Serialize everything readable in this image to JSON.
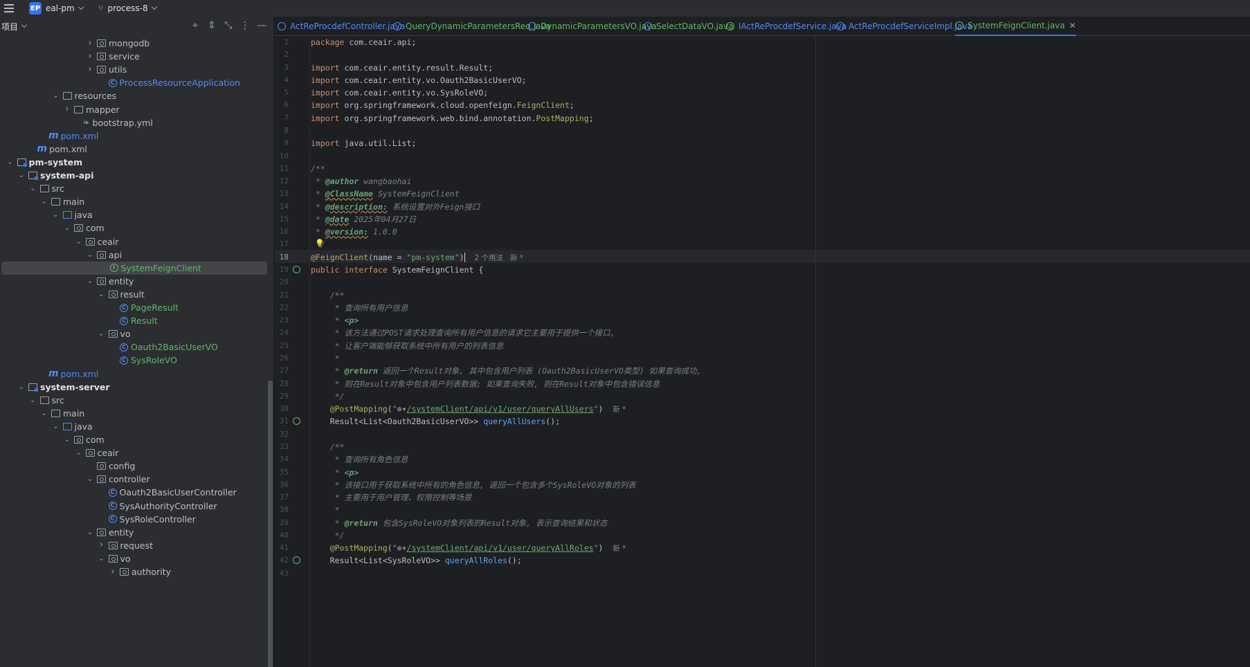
{
  "titlebar": {
    "project_badge": "EP",
    "project_name": "eal-pm",
    "branch": "process-8"
  },
  "project_panel": {
    "title": "项目",
    "tree": [
      {
        "label": "mongodb",
        "depth": 8,
        "icon": "package",
        "arrow": "closed"
      },
      {
        "label": "service",
        "depth": 8,
        "icon": "package",
        "arrow": "closed"
      },
      {
        "label": "utils",
        "depth": 8,
        "icon": "package",
        "arrow": "closed"
      },
      {
        "label": "ProcessResourceApplication",
        "depth": 9,
        "icon": "class",
        "color": "blue"
      },
      {
        "label": "resources",
        "depth": 5,
        "icon": "folder",
        "arrow": "open"
      },
      {
        "label": "mapper",
        "depth": 6,
        "icon": "folder",
        "arrow": "closed"
      },
      {
        "label": "bootstrap.yml",
        "depth": 7,
        "icon": "yaml"
      },
      {
        "label": "pom.xml",
        "depth": 4,
        "icon": "maven",
        "color": "blue"
      },
      {
        "label": "pom.xml",
        "depth": 3,
        "icon": "maven"
      },
      {
        "label": "pm-system",
        "depth": 1,
        "icon": "module",
        "arrow": "open",
        "bold": true
      },
      {
        "label": "system-api",
        "depth": 2,
        "icon": "module",
        "arrow": "open",
        "bold": true
      },
      {
        "label": "src",
        "depth": 3,
        "icon": "folder",
        "arrow": "open"
      },
      {
        "label": "main",
        "depth": 4,
        "icon": "folder",
        "arrow": "open"
      },
      {
        "label": "java",
        "depth": 5,
        "icon": "source",
        "arrow": "open"
      },
      {
        "label": "com",
        "depth": 6,
        "icon": "package",
        "arrow": "open"
      },
      {
        "label": "ceair",
        "depth": 7,
        "icon": "package",
        "arrow": "open"
      },
      {
        "label": "api",
        "depth": 8,
        "icon": "package",
        "arrow": "open"
      },
      {
        "label": "SystemFeignClient",
        "depth": 9,
        "icon": "interface",
        "color": "green",
        "selected": true
      },
      {
        "label": "entity",
        "depth": 8,
        "icon": "package",
        "arrow": "open"
      },
      {
        "label": "result",
        "depth": 9,
        "icon": "package",
        "arrow": "open"
      },
      {
        "label": "PageResult",
        "depth": 10,
        "icon": "class",
        "color": "green"
      },
      {
        "label": "Result",
        "depth": 10,
        "icon": "class",
        "color": "green"
      },
      {
        "label": "vo",
        "depth": 9,
        "icon": "package",
        "arrow": "open"
      },
      {
        "label": "Oauth2BasicUserVO",
        "depth": 10,
        "icon": "class",
        "color": "green"
      },
      {
        "label": "SysRoleVO",
        "depth": 10,
        "icon": "class",
        "color": "green"
      },
      {
        "label": "pom.xml",
        "depth": 4,
        "icon": "maven",
        "color": "blue"
      },
      {
        "label": "system-server",
        "depth": 2,
        "icon": "module",
        "arrow": "open",
        "bold": true
      },
      {
        "label": "src",
        "depth": 3,
        "icon": "folder",
        "arrow": "open"
      },
      {
        "label": "main",
        "depth": 4,
        "icon": "folder",
        "arrow": "open"
      },
      {
        "label": "java",
        "depth": 5,
        "icon": "source",
        "arrow": "open"
      },
      {
        "label": "com",
        "depth": 6,
        "icon": "package",
        "arrow": "open"
      },
      {
        "label": "ceair",
        "depth": 7,
        "icon": "package",
        "arrow": "open"
      },
      {
        "label": "config",
        "depth": 8,
        "icon": "package"
      },
      {
        "label": "controller",
        "depth": 8,
        "icon": "package",
        "arrow": "open"
      },
      {
        "label": "Oauth2BasicUserController",
        "depth": 9,
        "icon": "class"
      },
      {
        "label": "SysAuthorityController",
        "depth": 9,
        "icon": "class"
      },
      {
        "label": "SysRoleController",
        "depth": 9,
        "icon": "class"
      },
      {
        "label": "entity",
        "depth": 8,
        "icon": "package",
        "arrow": "open"
      },
      {
        "label": "request",
        "depth": 9,
        "icon": "package",
        "arrow": "closed"
      },
      {
        "label": "vo",
        "depth": 9,
        "icon": "package",
        "arrow": "open"
      },
      {
        "label": "authority",
        "depth": 10,
        "icon": "package",
        "arrow": "closed"
      }
    ]
  },
  "tabs": [
    {
      "label": "ActReProcdefController.java",
      "icon": "class",
      "color": "blue"
    },
    {
      "label": "QueryDynamicParametersReq.java",
      "icon": "class",
      "color": "green"
    },
    {
      "label": "DynamicParametersVO.java",
      "icon": "class",
      "color": "green"
    },
    {
      "label": "SelectDataVO.java",
      "icon": "class",
      "color": "green"
    },
    {
      "label": "IActReProcdefService.java",
      "icon": "interface",
      "color": "blue"
    },
    {
      "label": "ActReProcdefServiceImpl.java",
      "icon": "class",
      "color": "blue"
    },
    {
      "label": "SystemFeignClient.java",
      "icon": "interface",
      "color": "green",
      "active": true
    }
  ],
  "editor": {
    "current_line": 18,
    "lines": [
      "package com.ceair.api;",
      "",
      "import com.ceair.entity.result.Result;",
      "import com.ceair.entity.vo.Oauth2BasicUserVO;",
      "import com.ceair.entity.vo.SysRoleVO;",
      "import org.springframework.cloud.openfeign.FeignClient;",
      "import org.springframework.web.bind.annotation.PostMapping;",
      "",
      "import java.util.List;",
      "",
      "/**",
      " * @author wangbaohai",
      " * @ClassName SystemFeignClient",
      " * @description: 系统设置对外Feign接口",
      " * @date 2025年04月27日",
      " * @version: 1.0.0",
      " */",
      "@FeignClient(name = \"pm-system\")",
      "public interface SystemFeignClient {",
      "",
      "    /**",
      "     * 查询所有用户信息",
      "     * <p>",
      "     * 该方法通过POST请求处理查询所有用户信息的请求它主要用于提供一个接口,",
      "     * 让客户端能够获取系统中所有用户的列表信息",
      "     *",
      "     * @return 返回一个Result对象, 其中包含用户列表 (Oauth2BasicUserVO类型) 如果查询成功,",
      "     * 则在Result对象中包含用户列表数据; 如果查询失败, 则在Result对象中包含错误信息",
      "     */",
      "    @PostMapping(\"/systemClient/api/v1/user/queryAllUsers\")",
      "    Result<List<Oauth2BasicUserVO>> queryAllUsers();",
      "",
      "    /**",
      "     * 查询所有角色信息",
      "     * <p>",
      "     * 该接口用于获取系统中所有的角色信息, 返回一个包含多个SysRoleVO对象的列表",
      "     * 主要用于用户管理、权限控制等场景",
      "     *",
      "     * @return 包含SysRoleVO对象列表的Result对象, 表示查询结果和状态",
      "     */",
      "    @PostMapping(\"/systemClient/api/v1/user/queryAllRoles\")",
      "    Result<List<SysRoleVO>> queryAllRoles();",
      ""
    ],
    "inlay_hints": {
      "line18": "2 个用法",
      "new_marker": "新 *"
    }
  }
}
